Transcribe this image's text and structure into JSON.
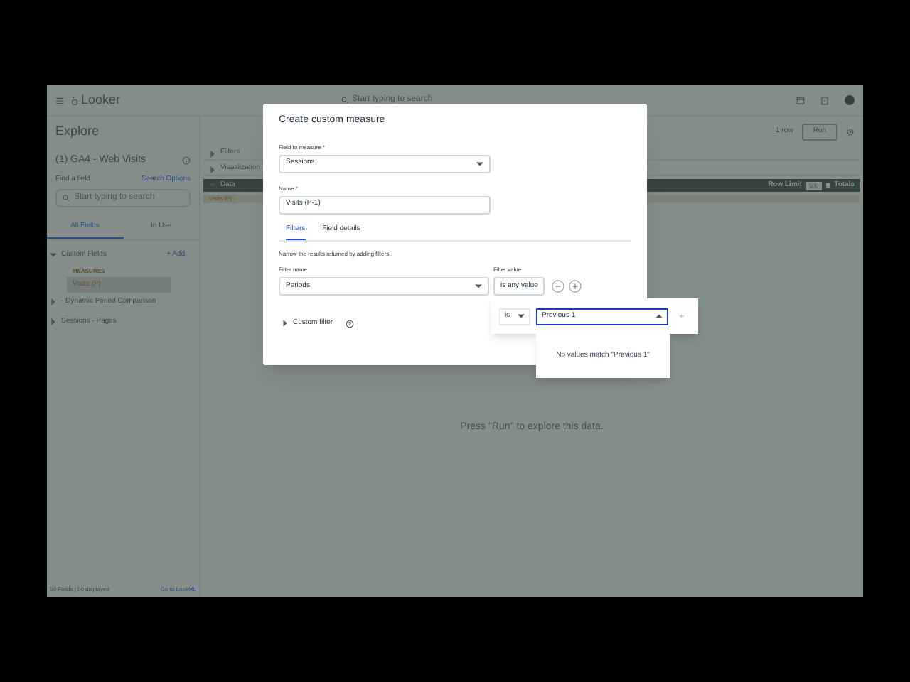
{
  "header": {
    "app_name": "Looker",
    "search_placeholder": "Start typing to search"
  },
  "sidebar": {
    "title": "Explore",
    "explore_name": "(1) GA4 - Web Visits",
    "find_label": "Find a field",
    "search_options": "Search Options",
    "search_placeholder": "Start typing to search",
    "tabs": [
      {
        "label": "All Fields",
        "selected": true
      },
      {
        "label": "In Use",
        "selected": false
      }
    ],
    "groups": [
      {
        "label": "Custom Fields",
        "expanded": true,
        "action": "+ Add",
        "children": [
          {
            "label": "MEASURES",
            "kind": "heading"
          },
          {
            "label": "Visits (P)",
            "kind": "field"
          }
        ]
      },
      {
        "label": "- Dynamic Period Comparison",
        "expanded": false
      },
      {
        "label": "Sessions - Pages",
        "expanded": false
      }
    ],
    "footer_count": "50 Fields | 50 displayed",
    "footer_link": "Go to LookML"
  },
  "main": {
    "row_count": "1 row",
    "run_button": "Run",
    "sections": [
      {
        "label": "Filters",
        "expanded": false
      },
      {
        "label": "Visualization",
        "expanded": false
      },
      {
        "label": "Data",
        "expanded": true
      }
    ],
    "row_limit_label": "Row Limit",
    "row_limit_value": "500",
    "totals_label": "Totals",
    "column_header": "Visits (P)",
    "empty_message": "Press \"Run\" to explore this data."
  },
  "dialog": {
    "title": "Create custom measure",
    "field_label": "Field to measure *",
    "field_value": "Sessions",
    "name_label": "Name *",
    "name_value": "Visits (P-1)",
    "tabs": [
      {
        "label": "Filters",
        "selected": true
      },
      {
        "label": "Field details",
        "selected": false
      }
    ],
    "description": "Narrow the results returned by adding filters.",
    "filter_name_label": "Filter name",
    "filter_name_value": "Periods",
    "filter_value_label": "Filter value",
    "filter_value": "is any value",
    "custom_filter": "Custom filter",
    "popover": {
      "operator": "is",
      "input_value": "Previous 1",
      "no_match": "No values match \"Previous 1\""
    }
  }
}
